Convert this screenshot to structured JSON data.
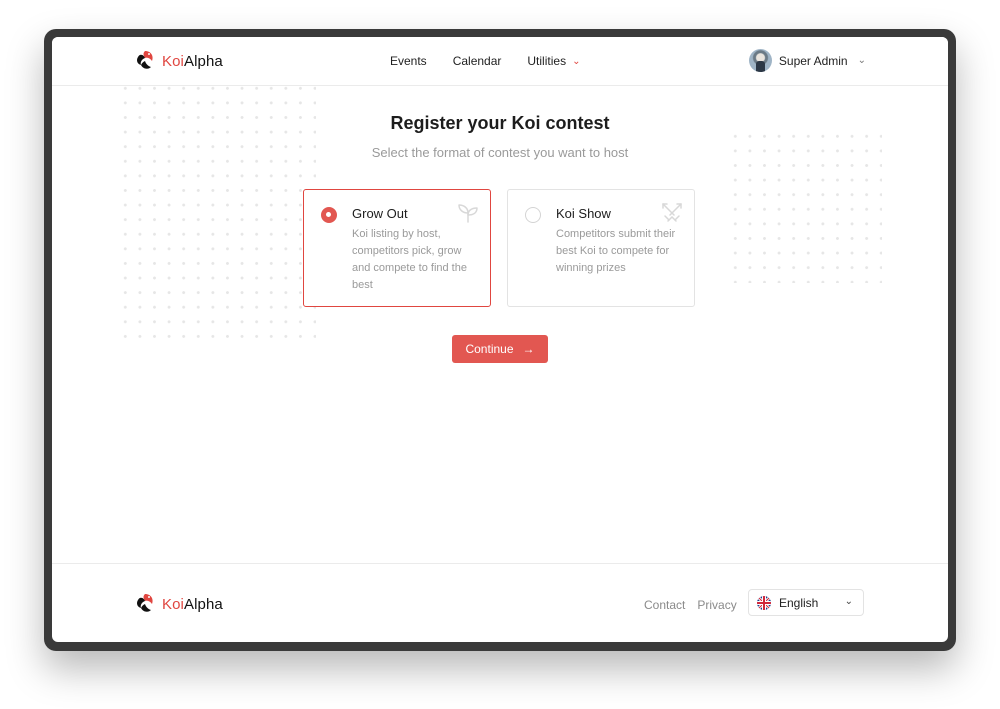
{
  "brand": {
    "koi": "Koi",
    "alpha": "Alpha",
    "accent": "#e04640"
  },
  "nav": {
    "events": "Events",
    "calendar": "Calendar",
    "utilities": "Utilities"
  },
  "user": {
    "name": "Super Admin"
  },
  "page": {
    "title": "Register your Koi contest",
    "subtitle": "Select the format of contest you want to host"
  },
  "options": [
    {
      "title": "Grow Out",
      "description": "Koi listing by host, competitors pick, grow and compete to find the best",
      "selected": true,
      "icon": "sprout-icon"
    },
    {
      "title": "Koi Show",
      "description": "Competitors submit their best Koi to compete for winning prizes",
      "selected": false,
      "icon": "swords-icon"
    }
  ],
  "actions": {
    "continue": "Continue"
  },
  "footer": {
    "contact": "Contact",
    "privacy": "Privacy",
    "language": "English",
    "flag_icon": "uk-flag-icon"
  }
}
